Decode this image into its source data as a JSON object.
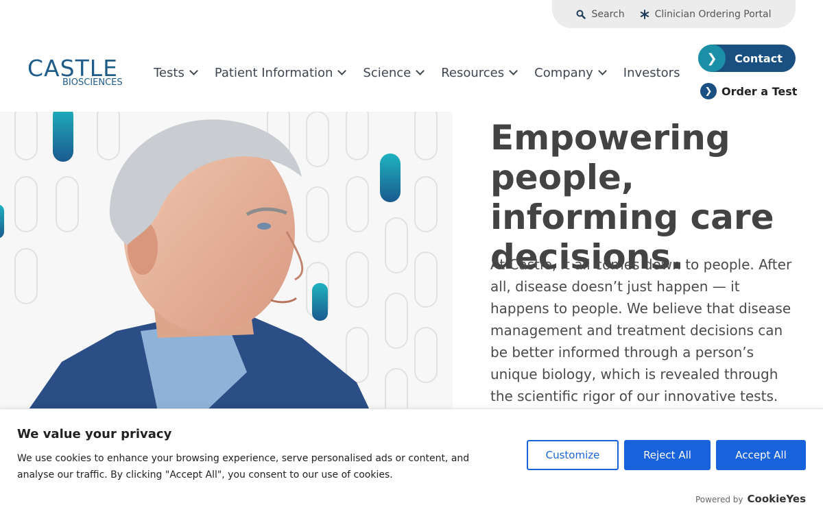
{
  "util_bar": {
    "search_label": "Search",
    "search_icon": "search-icon",
    "portal_label": "Clinician Ordering Portal",
    "portal_icon": "asterisk-icon"
  },
  "logo": {
    "main": "CASTLE",
    "sub": "BIOSCIENCES"
  },
  "nav": {
    "items": [
      {
        "label": "Tests",
        "has_dropdown": true
      },
      {
        "label": "Patient Information",
        "has_dropdown": true
      },
      {
        "label": "Science",
        "has_dropdown": true
      },
      {
        "label": "Resources",
        "has_dropdown": true
      },
      {
        "label": "Company",
        "has_dropdown": true
      },
      {
        "label": "Investors",
        "has_dropdown": false
      }
    ]
  },
  "cta": {
    "contact_label": "Contact",
    "contact_icon": "chevron-right-icon",
    "order_label": "Order a Test",
    "order_icon": "chevron-right-icon"
  },
  "hero": {
    "title": "Empowering people, informing care decisions.",
    "body": "At Castle, it all comes down to people. After all, disease doesn’t just happen — it happens to people. We believe that disease management and treatment decisions can be better informed through a person’s unique biology, which is revealed through the scientific rigor of our innovative tests. We are committed to"
  },
  "cookie": {
    "title": "We value your privacy",
    "text": "We use cookies to enhance your browsing experience, serve personalised ads or content, and analyse our traffic. By clicking \"Accept All\", you consent to our use of cookies.",
    "customize_label": "Customize",
    "reject_label": "Reject All",
    "accept_label": "Accept All",
    "powered_label": "Powered by",
    "powered_brand": "CookieYes"
  },
  "colors": {
    "brand_navy": "#1a4f82",
    "brand_teal": "#1a8fa5",
    "cookie_blue": "#1863dc"
  }
}
